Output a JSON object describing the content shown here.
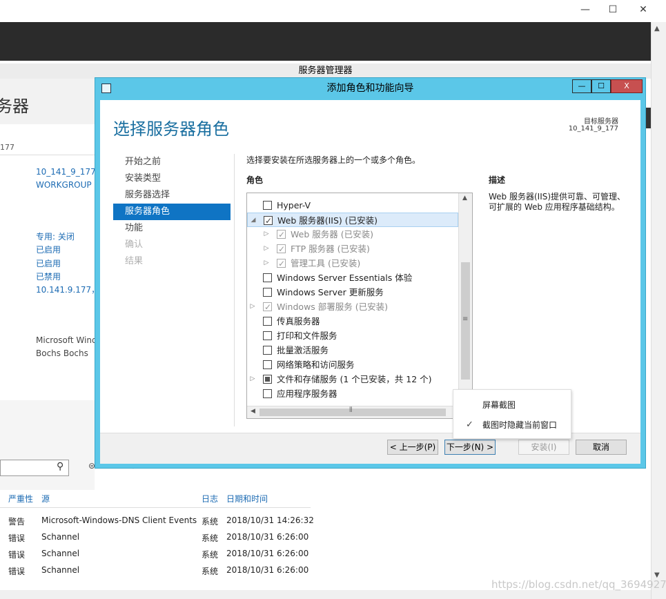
{
  "host": {
    "controls": [
      "—",
      "☐",
      "✕"
    ]
  },
  "server_manager": {
    "title": "服务器管理器",
    "header": "务器",
    "server_suffix": "177",
    "links": [
      "10_141_9_177",
      "WORKGROUP",
      "专用: 关闭",
      "已启用",
      "已启用",
      "已禁用",
      "10.141.9.177，"
    ],
    "os_lines": [
      "Microsoft Wind",
      "Bochs Bochs"
    ],
    "events": {
      "headers": [
        "严重性",
        "源",
        "日志",
        "日期和时间"
      ],
      "rows": [
        {
          "severity": "警告",
          "source": "Microsoft-Windows-DNS Client Events",
          "log": "系统",
          "datetime": "2018/10/31 14:26:32"
        },
        {
          "severity": "错误",
          "source": "Schannel",
          "log": "系统",
          "datetime": "2018/10/31 6:26:00"
        },
        {
          "severity": "错误",
          "source": "Schannel",
          "log": "系统",
          "datetime": "2018/10/31 6:26:00"
        },
        {
          "severity": "错误",
          "source": "Schannel",
          "log": "系统",
          "datetime": "2018/10/31 6:26:00"
        }
      ]
    },
    "watermark": "https://blog.csdn.net/qq_36949278"
  },
  "dialog": {
    "title": "添加角色和功能向导",
    "heading": "选择服务器角色",
    "target_label": "目标服务器",
    "target_value": "10_141_9_177",
    "nav": [
      {
        "label": "开始之前",
        "state": "normal"
      },
      {
        "label": "安装类型",
        "state": "normal"
      },
      {
        "label": "服务器选择",
        "state": "normal"
      },
      {
        "label": "服务器角色",
        "state": "active"
      },
      {
        "label": "功能",
        "state": "normal"
      },
      {
        "label": "确认",
        "state": "disabled"
      },
      {
        "label": "结果",
        "state": "disabled"
      }
    ],
    "instruction": "选择要安装在所选服务器上的一个或多个角色。",
    "roles_header": "角色",
    "description_header": "描述",
    "description": "Web 服务器(IIS)提供可靠、可管理、可扩展的 Web 应用程序基础结构。",
    "roles": [
      {
        "label": "Hyper-V",
        "checked": false,
        "installed": false,
        "expander": "",
        "indent": 0,
        "selected": false
      },
      {
        "label": "Web 服务器(IIS) (已安装)",
        "checked": true,
        "installed": false,
        "expander": "◢",
        "indent": 0,
        "selected": true
      },
      {
        "label": "Web 服务器 (已安装)",
        "checked": true,
        "installed": true,
        "expander": "▷",
        "indent": 1,
        "selected": false
      },
      {
        "label": "FTP 服务器 (已安装)",
        "checked": true,
        "installed": true,
        "expander": "▷",
        "indent": 1,
        "selected": false
      },
      {
        "label": "管理工具 (已安装)",
        "checked": true,
        "installed": true,
        "expander": "▷",
        "indent": 1,
        "selected": false
      },
      {
        "label": "Windows Server Essentials 体验",
        "checked": false,
        "installed": false,
        "expander": "",
        "indent": 0,
        "selected": false
      },
      {
        "label": "Windows Server 更新服务",
        "checked": false,
        "installed": false,
        "expander": "",
        "indent": 0,
        "selected": false
      },
      {
        "label": "Windows 部署服务 (已安装)",
        "checked": true,
        "installed": true,
        "expander": "▷",
        "indent": 0,
        "selected": false
      },
      {
        "label": "传真服务器",
        "checked": false,
        "installed": false,
        "expander": "",
        "indent": 0,
        "selected": false
      },
      {
        "label": "打印和文件服务",
        "checked": false,
        "installed": false,
        "expander": "",
        "indent": 0,
        "selected": false
      },
      {
        "label": "批量激活服务",
        "checked": false,
        "installed": false,
        "expander": "",
        "indent": 0,
        "selected": false
      },
      {
        "label": "网络策略和访问服务",
        "checked": false,
        "installed": false,
        "expander": "",
        "indent": 0,
        "selected": false
      },
      {
        "label": "文件和存储服务 (1 个已安装，共 12 个)",
        "checked": "partial",
        "installed": false,
        "expander": "▷",
        "indent": 0,
        "selected": false
      },
      {
        "label": "应用程序服务器",
        "checked": false,
        "installed": false,
        "expander": "",
        "indent": 0,
        "selected": false
      }
    ],
    "buttons": {
      "prev": "< 上一步(P)",
      "next": "下一步(N) >",
      "install": "安装(I)",
      "cancel": "取消"
    },
    "window_controls": [
      "—",
      "☐",
      "X"
    ]
  },
  "popup": {
    "items": [
      "屏幕截图",
      "截图时隐藏当前窗口"
    ]
  }
}
